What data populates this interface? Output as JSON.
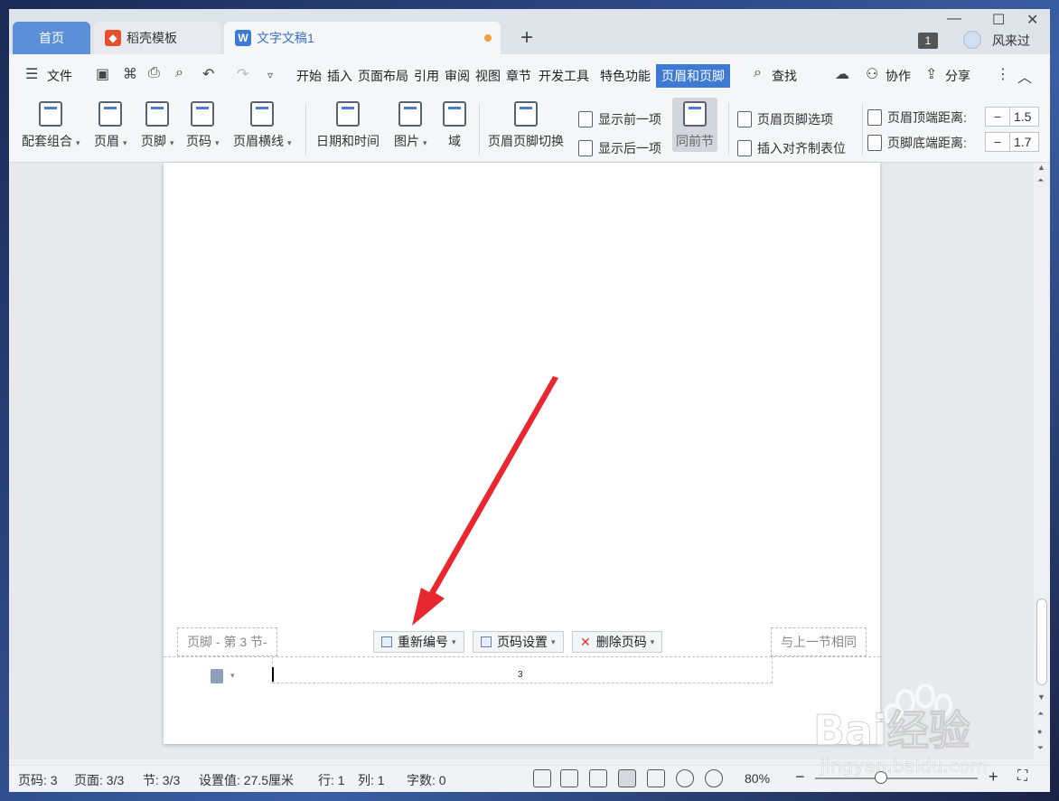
{
  "titlebar": {
    "tabs": [
      {
        "label": "首页"
      },
      {
        "label": "稻壳模板"
      },
      {
        "label": "文字文稿1"
      }
    ],
    "new_tab": "+",
    "badge": "1",
    "username": "风来过"
  },
  "menubar": {
    "file": "文件",
    "items": [
      "开始",
      "插入",
      "页面布局",
      "引用",
      "审阅",
      "视图",
      "章节",
      "开发工具",
      "特色功能",
      "页眉和页脚"
    ],
    "search": "查找",
    "collab": "协作",
    "share": "分享"
  },
  "ribbon": {
    "combo": "配套组合",
    "header": "页眉",
    "footer": "页脚",
    "pagenum": "页码",
    "header_line": "页眉横线",
    "datetime": "日期和时间",
    "picture": "图片",
    "field": "域",
    "switch": "页眉页脚切换",
    "show_prev": "显示前一项",
    "show_next": "显示后一项",
    "same_prev": "同前节",
    "hf_options": "页眉页脚选项",
    "insert_align_tab": "插入对齐制表位",
    "header_top_dist": "页眉顶端距离:",
    "footer_bottom_dist": "页脚底端距离:",
    "header_top_val": "1.5",
    "footer_bottom_val": "1.7",
    "minus": "−"
  },
  "document": {
    "footer_label": "页脚 - 第 3 节-",
    "renumber": "重新编号",
    "page_settings": "页码设置",
    "delete_pagenum": "删除页码",
    "same_as_prev": "与上一节相同",
    "page_number": "3"
  },
  "statusbar": {
    "page_num": "页码: 3",
    "page": "页面: 3/3",
    "section": "节: 3/3",
    "setting": "设置值: 27.5厘米",
    "row": "行: 1",
    "col": "列: 1",
    "words": "字数: 0",
    "zoom": "80%"
  },
  "colors": {
    "accent": "#3d7ad6",
    "arrow": "#e8282e"
  },
  "watermark": {
    "text": "Bai经验",
    "url": "jingyan.baidu.com"
  }
}
